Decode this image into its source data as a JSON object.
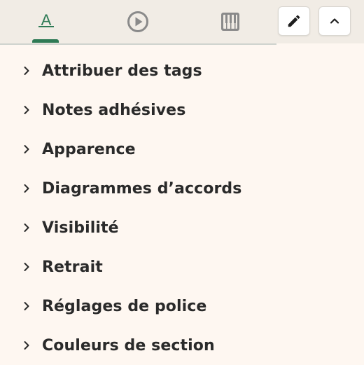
{
  "toolbar": {
    "tabs": [
      {
        "name": "text",
        "glyph": "A",
        "active": true
      },
      {
        "name": "playback",
        "glyph": "play-circle-icon",
        "active": false
      },
      {
        "name": "piano",
        "glyph": "piano-icon",
        "active": false
      }
    ],
    "accent_color": "#2e7a55",
    "edit_icon": "pencil-icon",
    "collapse_icon": "chevron-up-icon"
  },
  "menu": {
    "items": [
      {
        "label": "Attribuer des tags"
      },
      {
        "label": "Notes adhésives"
      },
      {
        "label": "Apparence"
      },
      {
        "label": "Diagrammes d’accords"
      },
      {
        "label": "Visibilité"
      },
      {
        "label": "Retrait"
      },
      {
        "label": "Réglages de police"
      },
      {
        "label": "Couleurs de section"
      }
    ]
  },
  "colors": {
    "background": "#fef7f1",
    "toolbar_background": "#f1ece5",
    "text": "#2a2a2a"
  }
}
